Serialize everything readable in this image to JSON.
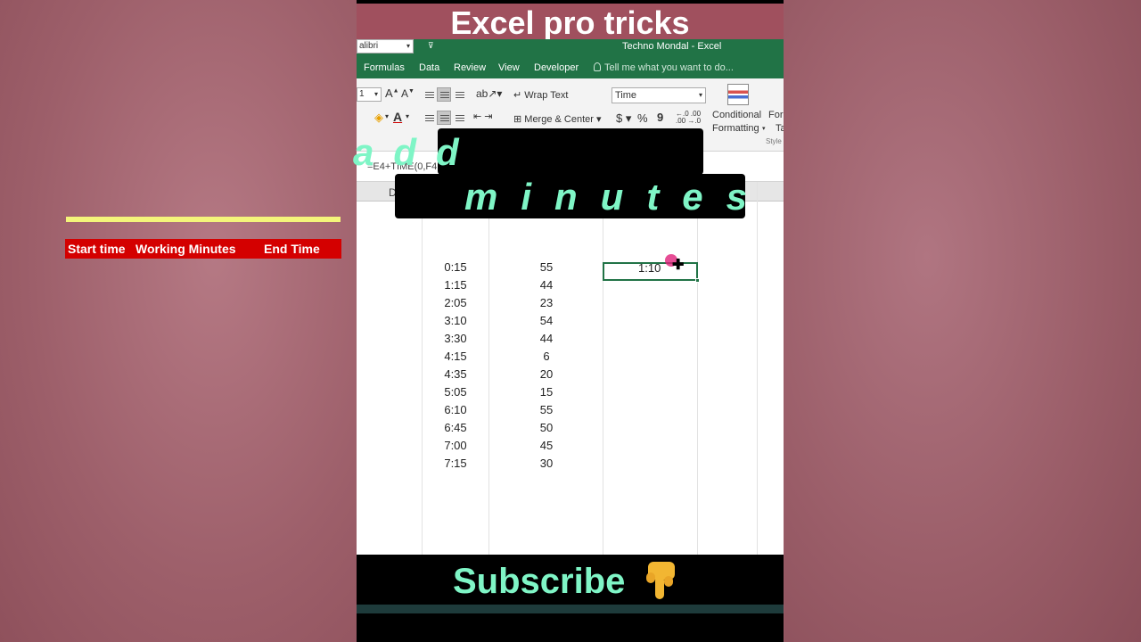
{
  "video_title": "Excel pro tricks",
  "excel": {
    "font_name": "alibri",
    "font_size": "1",
    "window_title": "Techno Mondal - Excel",
    "tabs": [
      "Formulas",
      "Data",
      "Review",
      "View",
      "Developer"
    ],
    "tell_me": "Tell me what you want to do...",
    "ribbon": {
      "wrap_text": "Wrap Text",
      "merge_center": "Merge & Center",
      "number_format": "Time",
      "currency": "$",
      "percent": "%",
      "comma": "9",
      "conditional_formatting_1": "Conditional",
      "conditional_formatting_2": "Formatting",
      "format_as_1": "For",
      "format_as_2": "Ta",
      "styles_group": "Style"
    },
    "formula": "=E4+TIME(0,F4",
    "column_header": "D"
  },
  "table": {
    "headers": [
      "Start time",
      "Working Minutes",
      "End Time"
    ],
    "rows": [
      {
        "start": "0:15",
        "minutes": "55",
        "end": "1:10"
      },
      {
        "start": "1:15",
        "minutes": "44",
        "end": ""
      },
      {
        "start": "2:05",
        "minutes": "23",
        "end": ""
      },
      {
        "start": "3:10",
        "minutes": "54",
        "end": ""
      },
      {
        "start": "3:30",
        "minutes": "44",
        "end": ""
      },
      {
        "start": "4:15",
        "minutes": "6",
        "end": ""
      },
      {
        "start": "4:35",
        "minutes": "20",
        "end": ""
      },
      {
        "start": "5:05",
        "minutes": "15",
        "end": ""
      },
      {
        "start": "6:10",
        "minutes": "55",
        "end": ""
      },
      {
        "start": "6:45",
        "minutes": "50",
        "end": ""
      },
      {
        "start": "7:00",
        "minutes": "45",
        "end": ""
      },
      {
        "start": "7:15",
        "minutes": "30",
        "end": ""
      }
    ]
  },
  "captions": {
    "line1": "add",
    "line2": "minutes"
  },
  "subscribe": "Subscribe",
  "colors": {
    "excel_green": "#217346",
    "header_red": "#d40000",
    "caption_green": "#7ff5c6"
  }
}
